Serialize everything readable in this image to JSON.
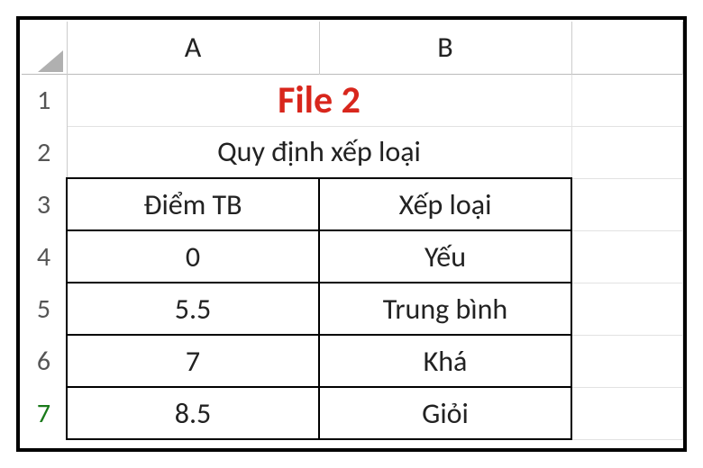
{
  "columns": {
    "a": "A",
    "b": "B"
  },
  "rownums": {
    "r1": "1",
    "r2": "2",
    "r3": "3",
    "r4": "4",
    "r5": "5",
    "r6": "6",
    "r7": "7"
  },
  "row1": {
    "title": "File 2"
  },
  "row2": {
    "subtitle": "Quy định xếp loại"
  },
  "headers": {
    "col_a": "Điểm TB",
    "col_b": "Xếp loại"
  },
  "data": [
    {
      "score": "0",
      "rank": "Yếu"
    },
    {
      "score": "5.5",
      "rank": "Trung bình"
    },
    {
      "score": "7",
      "rank": "Khá"
    },
    {
      "score": "8.5",
      "rank": "Giỏi"
    }
  ]
}
